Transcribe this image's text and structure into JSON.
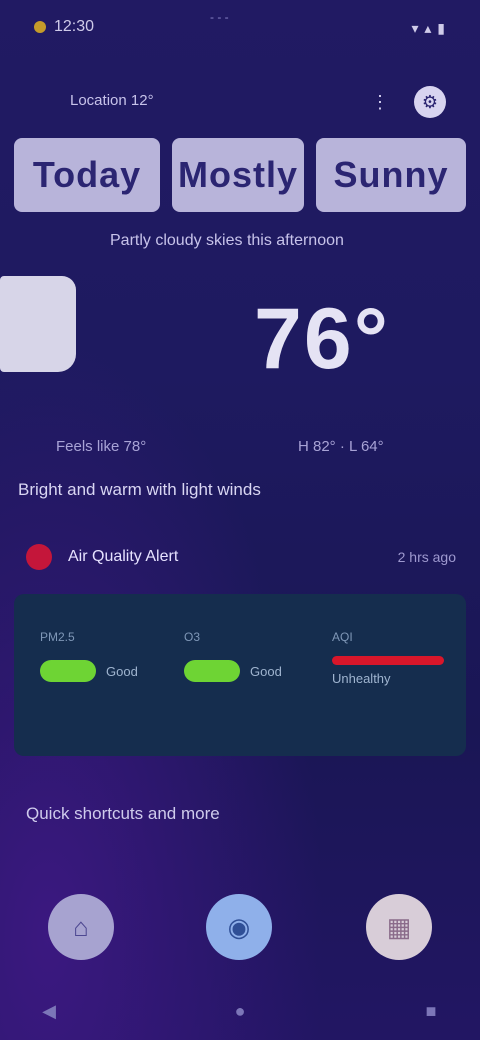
{
  "status_bar": {
    "time": "12:30",
    "center_label": "- - -",
    "right_icons": "▾ ▴ ▮"
  },
  "location": {
    "label": "Location 12°",
    "share_icon": "share-icon",
    "settings_icon": "settings-icon"
  },
  "banner": {
    "word1": "Today",
    "word2": "Mostly",
    "word3": "Sunny"
  },
  "subtitle": "Partly cloudy skies this afternoon",
  "current": {
    "temperature": "76°",
    "condition_icon": "cloud-icon",
    "feels_like": "Feels like 78°",
    "high_low": "H 82° · L 64°"
  },
  "summary": "Bright and warm with light winds",
  "alert": {
    "text": "Air Quality Alert",
    "time": "2 hrs ago",
    "color": "#c4163a"
  },
  "air_quality": {
    "items": [
      {
        "label": "PM2.5",
        "value": "Good",
        "color": "#6ed434"
      },
      {
        "label": "O3",
        "value": "Good",
        "color": "#6ed434"
      },
      {
        "label": "AQI",
        "value": "Unhealthy",
        "color": "#d8162a"
      }
    ]
  },
  "section": {
    "title": "Quick shortcuts and more"
  },
  "shortcuts": [
    {
      "icon": "home-icon",
      "glyph": "⌂"
    },
    {
      "icon": "map-icon",
      "glyph": "◉"
    },
    {
      "icon": "calendar-icon",
      "glyph": "▦"
    }
  ],
  "navbar": {
    "back": "◀",
    "home": "●",
    "recents": "■"
  }
}
